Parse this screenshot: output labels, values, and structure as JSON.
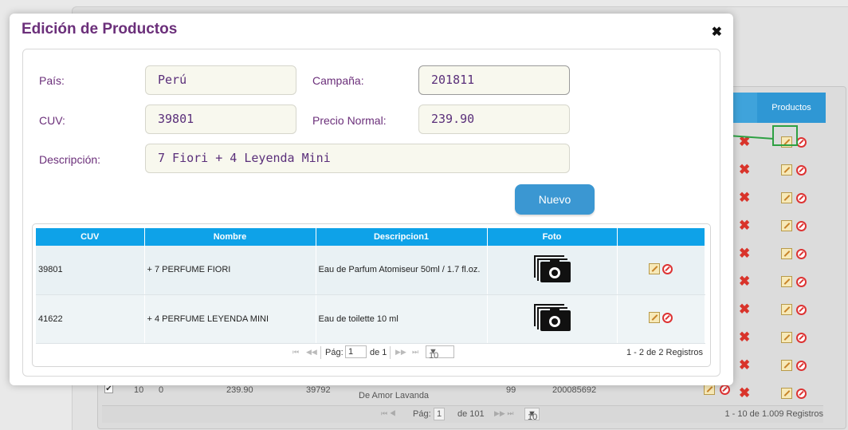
{
  "background": {
    "header_productos": "Productos",
    "bottom_row": {
      "checked": "✔",
      "col1": "10",
      "col2": "0",
      "price": "239.90",
      "cuv": "39792",
      "desc": "De Amor Lavanda",
      "qty": "99",
      "code": "200085692"
    },
    "pager": {
      "page_label": "Pág:",
      "page_value": "1",
      "of_label": "de 101",
      "rows_value": "10",
      "records": "1 - 10 de 1.009 Registros"
    }
  },
  "modal": {
    "title": "Edición de Productos",
    "close": "✖",
    "fields": {
      "pais_label": "País:",
      "pais_value": "Perú",
      "campana_label": "Campaña:",
      "campana_value": "201811",
      "cuv_label": "CUV:",
      "cuv_value": "39801",
      "precio_label": "Precio Normal:",
      "precio_value": "239.90",
      "descripcion_label": "Descripción:",
      "descripcion_value": "7 Fiori + 4 Leyenda Mini"
    },
    "nuevo_button": "Nuevo",
    "grid": {
      "headers": [
        "CUV",
        "Nombre",
        "Descripcion1",
        "Foto",
        ""
      ],
      "rows": [
        {
          "cuv": "39801",
          "nombre": "+ 7 PERFUME FIORI",
          "desc": "Eau de Parfum Atomiseur 50ml / 1.7 fl.oz."
        },
        {
          "cuv": "41622",
          "nombre": "+ 4 PERFUME LEYENDA MINI",
          "desc": "Eau de toilette 10 ml"
        }
      ],
      "pager": {
        "first": "⏮",
        "prev": "◀◀",
        "page_label": "Pág:",
        "page_value": "1",
        "of_label": "de 1",
        "next": "▶▶",
        "last": "⏭",
        "rows_value": "10",
        "records": "1 - 2 de 2 Registros"
      }
    }
  },
  "colors": {
    "accent_purple": "#6b2f7a",
    "header_blue": "#0ea2e8",
    "button_blue": "#3b97d2",
    "arrow_green": "#2ea043"
  }
}
